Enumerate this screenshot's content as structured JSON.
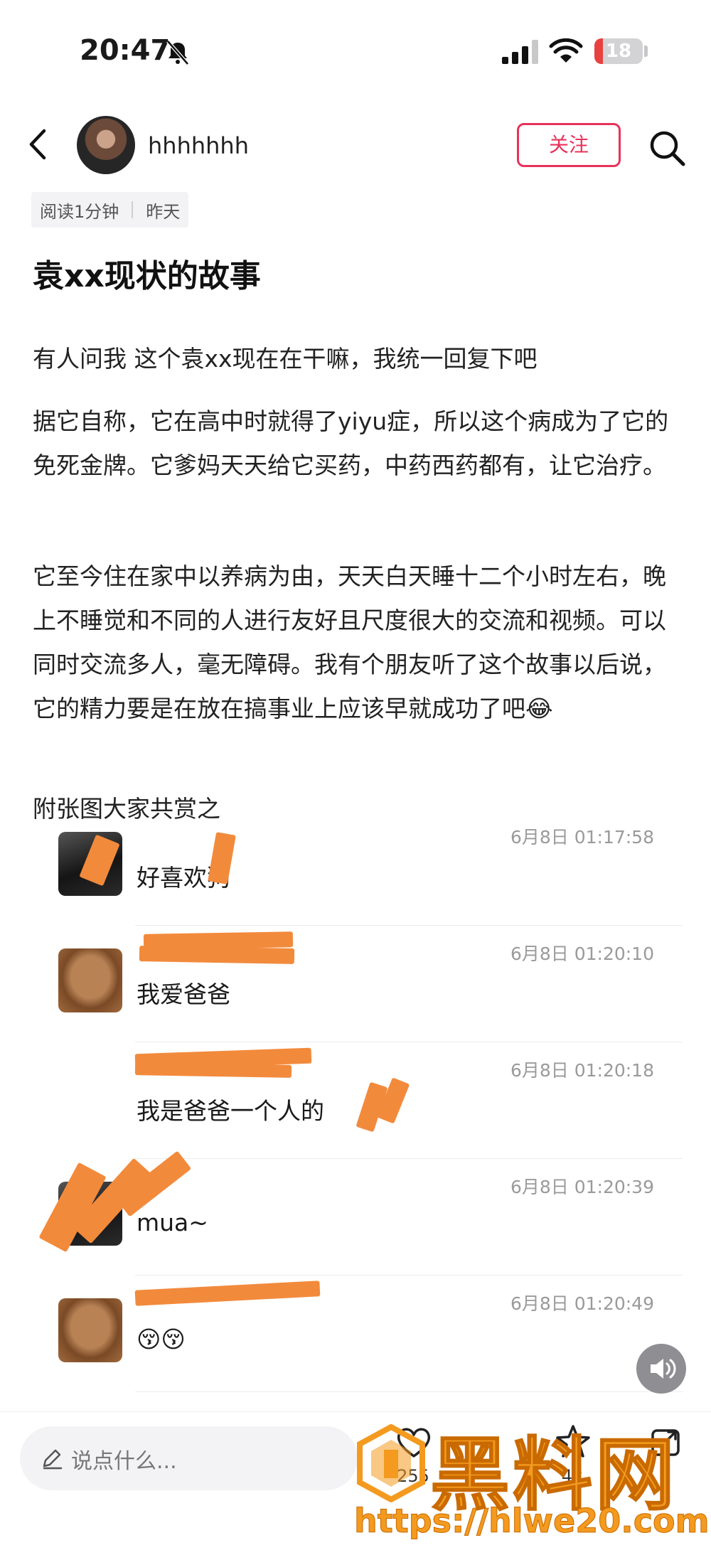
{
  "status_bar": {
    "time": "20:47",
    "battery": "18",
    "battery_fraction": 0.18
  },
  "header": {
    "username": "hhhhhhh",
    "follow_label": "关注"
  },
  "meta": {
    "read_time": "阅读1分钟",
    "date": "昨天"
  },
  "post": {
    "title": "袁xx现状的故事",
    "paragraphs": [
      "有人问我 这个袁xx现在在干嘛，我统一回复下吧",
      "据它自称，它在高中时就得了yiyu症，所以这个病成为了它的免死金牌。它爹妈天天给它买药，中药西药都有，让它治疗。",
      "它至今住在家中以养病为由，天天白天睡十二个小时左右，晚上不睡觉和不同的人进行友好且尺度很大的交流和视频。可以同时交流多人，毫无障碍。我有个朋友听了这个故事以后说，它的精力要是在放在搞事业上应该早就成功了吧😂",
      "附张图大家共赏之"
    ]
  },
  "chat": {
    "rows": [
      {
        "time": "6月8日 01:17:58",
        "message": "好喜欢狗"
      },
      {
        "time": "6月8日 01:20:10",
        "message": "我爱爸爸"
      },
      {
        "time": "6月8日 01:20:18",
        "message": "我是爸爸一个人的"
      },
      {
        "time": "6月8日 01:20:39",
        "message": "mua~"
      },
      {
        "time": "6月8日 01:20:49",
        "message": "😚😚"
      }
    ]
  },
  "bottom_bar": {
    "comment_placeholder": "说点什么...",
    "likes": "255",
    "collects": "42"
  },
  "watermark": {
    "title": "黑料网",
    "url": "https://hlwe20.com"
  },
  "colors": {
    "accent": "#e8325a",
    "redaction": "#f28a3c",
    "watermark": "#f39a1f"
  },
  "icons": [
    "bell-slash-icon",
    "signal-icon",
    "wifi-icon",
    "back-icon",
    "search-icon",
    "volume-icon",
    "pencil-icon",
    "heart-icon",
    "star-icon",
    "share-icon"
  ]
}
